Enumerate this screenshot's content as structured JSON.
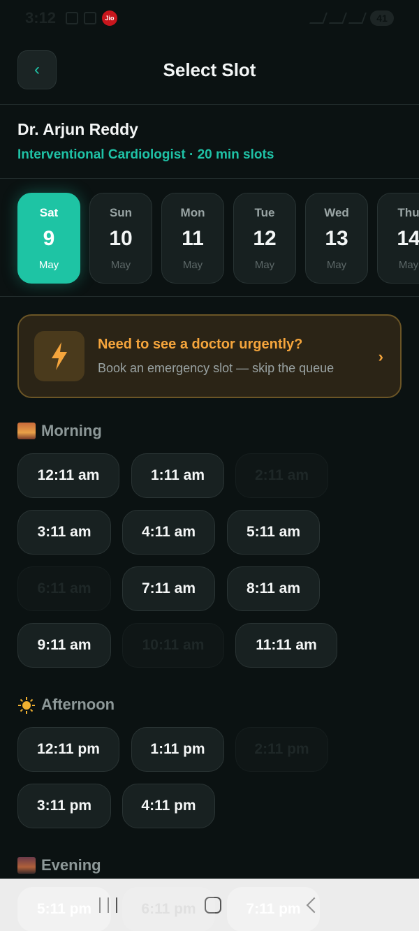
{
  "status_bar": {
    "time": "3:12",
    "carrier_badge": "Jio",
    "battery": "41"
  },
  "header": {
    "title": "Select Slot",
    "back_icon": "chevron-left-icon"
  },
  "doctor": {
    "name": "Dr. Arjun Reddy",
    "specialty": "Interventional Cardiologist · 20 min slots"
  },
  "dates": [
    {
      "dow": "Sat",
      "day": "9",
      "month": "May",
      "selected": true
    },
    {
      "dow": "Sun",
      "day": "10",
      "month": "May",
      "selected": false
    },
    {
      "dow": "Mon",
      "day": "11",
      "month": "May",
      "selected": false
    },
    {
      "dow": "Tue",
      "day": "12",
      "month": "May",
      "selected": false
    },
    {
      "dow": "Wed",
      "day": "13",
      "month": "May",
      "selected": false
    },
    {
      "dow": "Thu",
      "day": "14",
      "month": "May",
      "selected": false
    }
  ],
  "urgent": {
    "title": "Need to see a doctor urgently?",
    "subtitle": "Book an emergency slot — skip the queue",
    "icon": "lightning-bolt-icon",
    "chevron": "›"
  },
  "sections": {
    "morning": {
      "label": "Morning",
      "slots": [
        {
          "label": "12:11 am",
          "available": true
        },
        {
          "label": "1:11 am",
          "available": true
        },
        {
          "label": "2:11 am",
          "available": false
        },
        {
          "label": "3:11 am",
          "available": true
        },
        {
          "label": "4:11 am",
          "available": true
        },
        {
          "label": "5:11 am",
          "available": true
        },
        {
          "label": "6:11 am",
          "available": false
        },
        {
          "label": "7:11 am",
          "available": true
        },
        {
          "label": "8:11 am",
          "available": true
        },
        {
          "label": "9:11 am",
          "available": true
        },
        {
          "label": "10:11 am",
          "available": false
        },
        {
          "label": "11:11 am",
          "available": true
        }
      ]
    },
    "afternoon": {
      "label": "Afternoon",
      "slots": [
        {
          "label": "12:11 pm",
          "available": true
        },
        {
          "label": "1:11 pm",
          "available": true
        },
        {
          "label": "2:11 pm",
          "available": false
        },
        {
          "label": "3:11 pm",
          "available": true
        },
        {
          "label": "4:11 pm",
          "available": true
        }
      ]
    },
    "evening": {
      "label": "Evening",
      "slots": [
        {
          "label": "5:11 pm",
          "available": true
        },
        {
          "label": "6:11 pm",
          "available": false
        },
        {
          "label": "7:11 pm",
          "available": true
        }
      ]
    }
  },
  "colors": {
    "accent": "#1ec4a4",
    "background": "#0b1212",
    "urgent": "#f5a53c"
  }
}
